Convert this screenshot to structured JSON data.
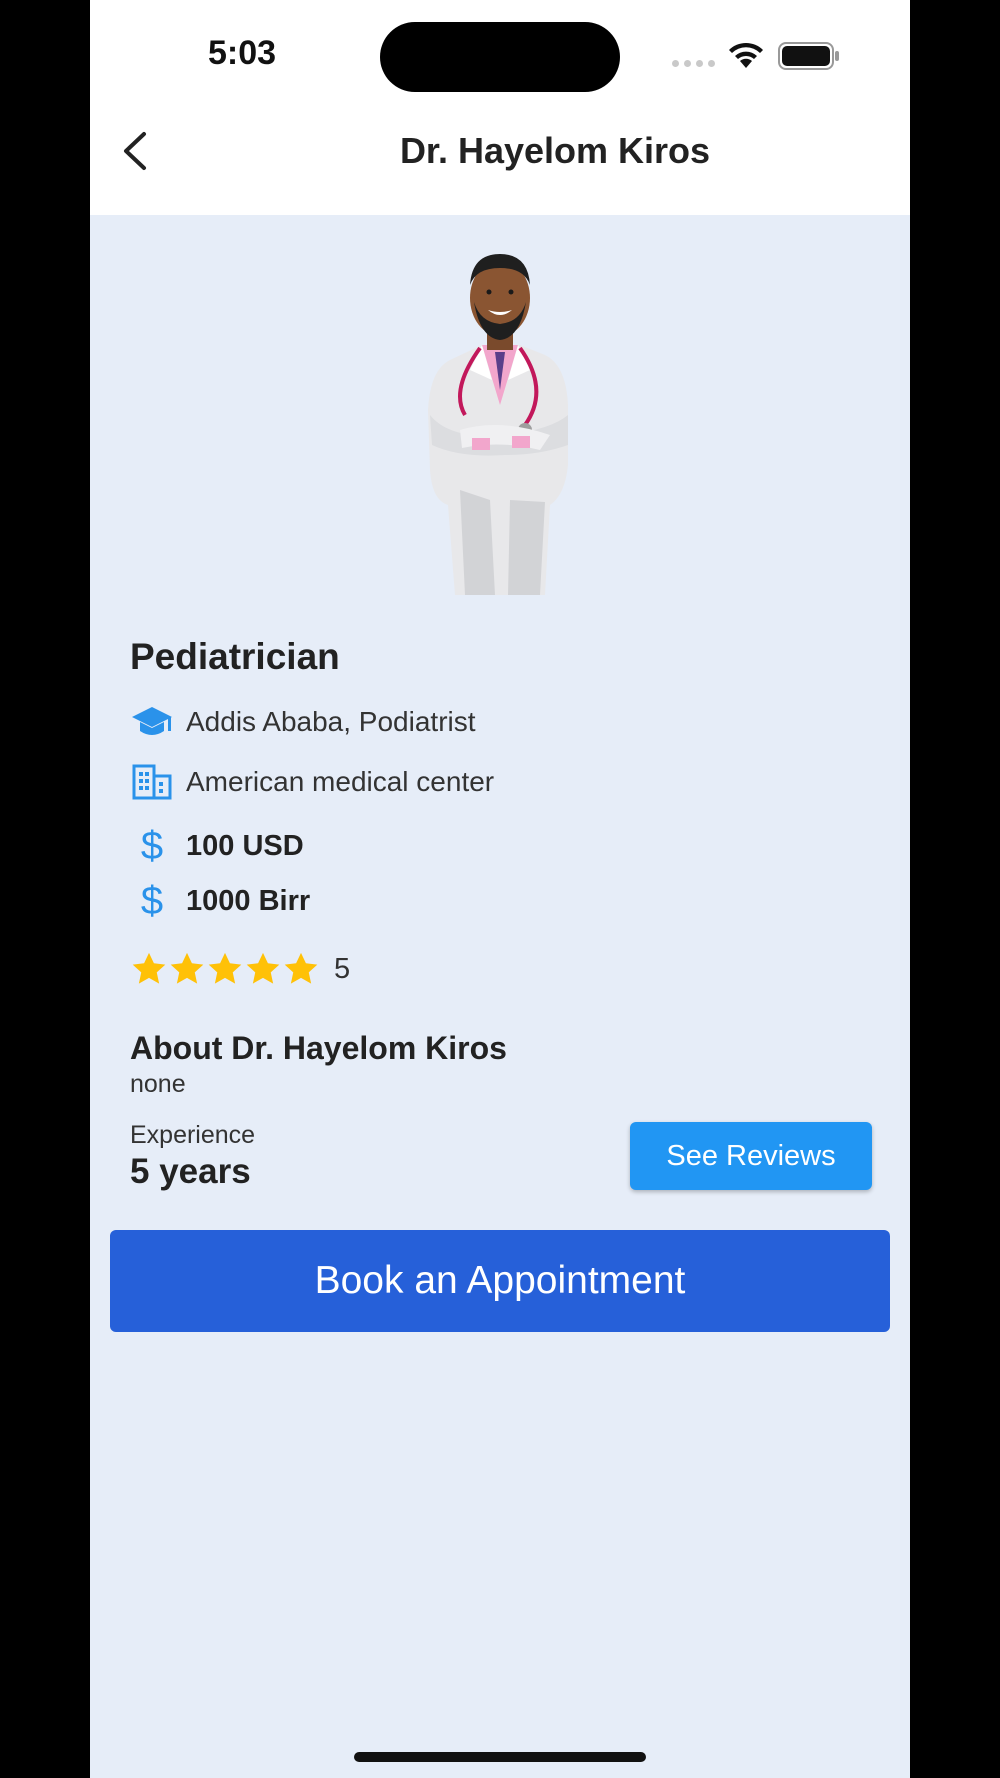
{
  "status_bar": {
    "time": "5:03",
    "icons": [
      "signal-icon",
      "wifi-icon",
      "battery-icon"
    ]
  },
  "header": {
    "title": "Dr. Hayelom Kiros",
    "back_icon": "chevron-left-icon"
  },
  "doctor": {
    "specialty": "Pediatrician",
    "education": "Addis Ababa, Podiatrist",
    "hospital": "American medical center",
    "fee_usd": "100 USD",
    "fee_birr": "1000 Birr",
    "rating_stars": 5,
    "rating_value": "5",
    "about_title": "About Dr. Hayelom Kiros",
    "about_text": "none",
    "experience_label": "Experience",
    "experience_value": "5 years"
  },
  "actions": {
    "see_reviews": "See Reviews",
    "book": "Book an Appointment"
  },
  "colors": {
    "background": "#e6edf8",
    "accent_blue": "#2196f3",
    "primary_button": "#2660d9",
    "star": "#ffc107",
    "icon_blue": "#2a92ea"
  }
}
